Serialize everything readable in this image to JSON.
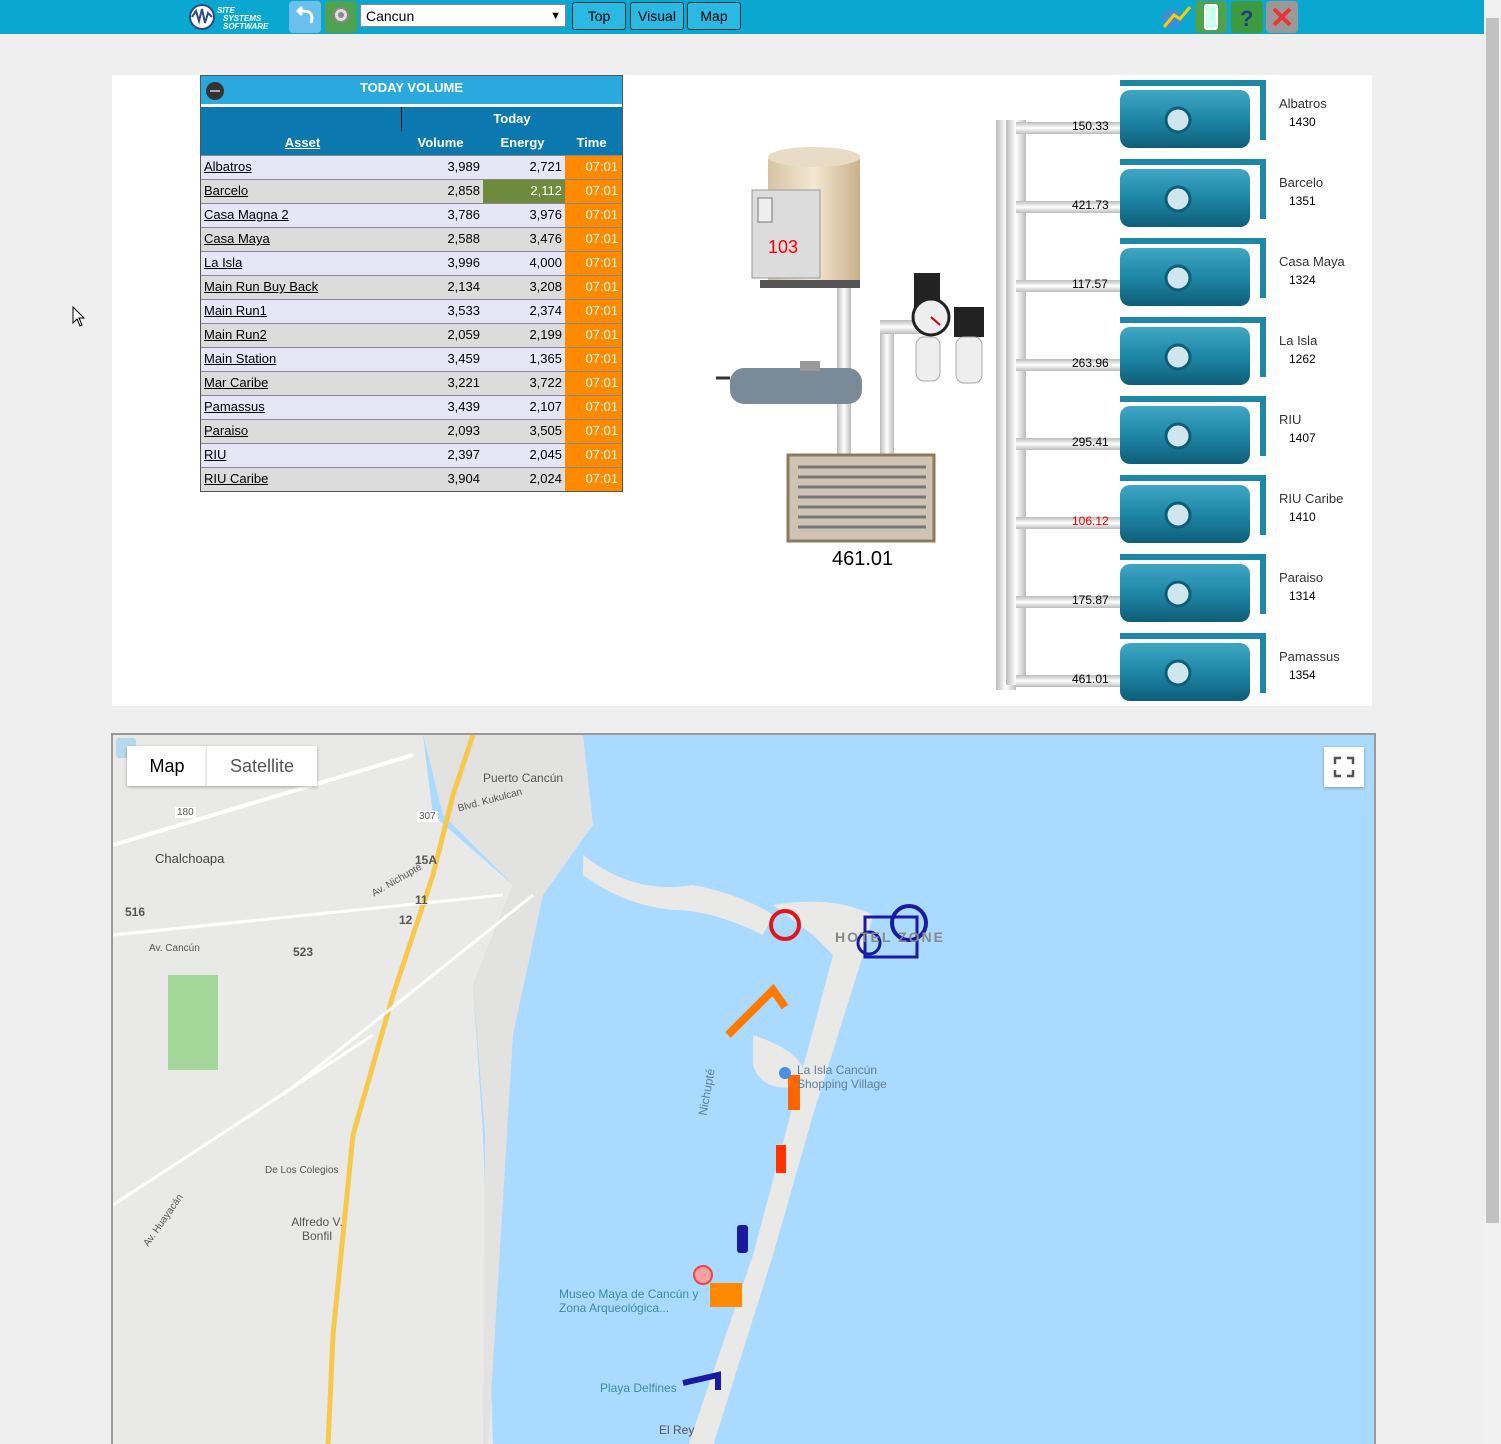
{
  "toolbar": {
    "logo_text": "SITE SYSTEMS SOFTWARE",
    "site_select": "Cancun",
    "nav": [
      "Top",
      "Visual",
      "Map"
    ]
  },
  "volume_table": {
    "title": "TODAY VOLUME",
    "group_header": "Today",
    "columns": [
      "Asset",
      "Volume",
      "Energy",
      "Time"
    ],
    "rows": [
      {
        "asset": "Albatros",
        "volume": "3,989",
        "energy": "2,721",
        "time": "07:01"
      },
      {
        "asset": "Barcelo",
        "volume": "2,858",
        "energy": "2,112",
        "time": "07:01",
        "energy_highlight": "#6e8b3d"
      },
      {
        "asset": "Casa Magna 2",
        "volume": "3,786",
        "energy": "3,976",
        "time": "07:01"
      },
      {
        "asset": "Casa Maya",
        "volume": "2,588",
        "energy": "3,476",
        "time": "07:01"
      },
      {
        "asset": "La Isla",
        "volume": "3,996",
        "energy": "4,000",
        "time": "07:01"
      },
      {
        "asset": "Main Run Buy Back",
        "volume": "2,134",
        "energy": "3,208",
        "time": "07:01"
      },
      {
        "asset": "Main Run1",
        "volume": "3,533",
        "energy": "2,374",
        "time": "07:01"
      },
      {
        "asset": "Main Run2",
        "volume": "2,059",
        "energy": "2,199",
        "time": "07:01"
      },
      {
        "asset": "Main Station",
        "volume": "3,459",
        "energy": "1,365",
        "time": "07:01"
      },
      {
        "asset": "Mar Caribe",
        "volume": "3,221",
        "energy": "3,722",
        "time": "07:01"
      },
      {
        "asset": "Pamassus",
        "volume": "3,439",
        "energy": "2,107",
        "time": "07:01"
      },
      {
        "asset": "Paraiso",
        "volume": "2,093",
        "energy": "3,505",
        "time": "07:01"
      },
      {
        "asset": "RIU",
        "volume": "2,397",
        "energy": "2,045",
        "time": "07:01"
      },
      {
        "asset": "RIU Caribe",
        "volume": "3,904",
        "energy": "2,024",
        "time": "07:01"
      }
    ]
  },
  "diagram": {
    "compressor_value": "103",
    "total_flow": "461.01",
    "tanks": [
      {
        "name": "Albatros",
        "id": "1430",
        "flow": "150.33"
      },
      {
        "name": "Barcelo",
        "id": "1351",
        "flow": "421.73"
      },
      {
        "name": "Casa Maya",
        "id": "1324",
        "flow": "117.57"
      },
      {
        "name": "La Isla",
        "id": "1262",
        "flow": "263.96"
      },
      {
        "name": "RIU",
        "id": "1407",
        "flow": "295.41"
      },
      {
        "name": "RIU Caribe",
        "id": "1410",
        "flow": "106.12",
        "alert": true
      },
      {
        "name": "Paraiso",
        "id": "1314",
        "flow": "175.87"
      },
      {
        "name": "Pamassus",
        "id": "1354",
        "flow": "461.01"
      }
    ]
  },
  "map": {
    "tabs": [
      "Map",
      "Satellite"
    ],
    "labels": [
      "Puerto Cancún",
      "Chalchoapa",
      "HOTEL ZONE",
      "La Isla Cancún Shopping Village",
      "Museo Maya de Cancún y Zona Arqueológica...",
      "Playa Delfines",
      "El Rey",
      "Alfredo V. Bonfil",
      "Nichupté",
      "Av. Cancún",
      "Av. Nichupté",
      "Blvd. Kukulcan",
      "De Los Colegios",
      "Av. Huayacán",
      "180",
      "307",
      "15A",
      "11",
      "12",
      "516",
      "523"
    ]
  }
}
